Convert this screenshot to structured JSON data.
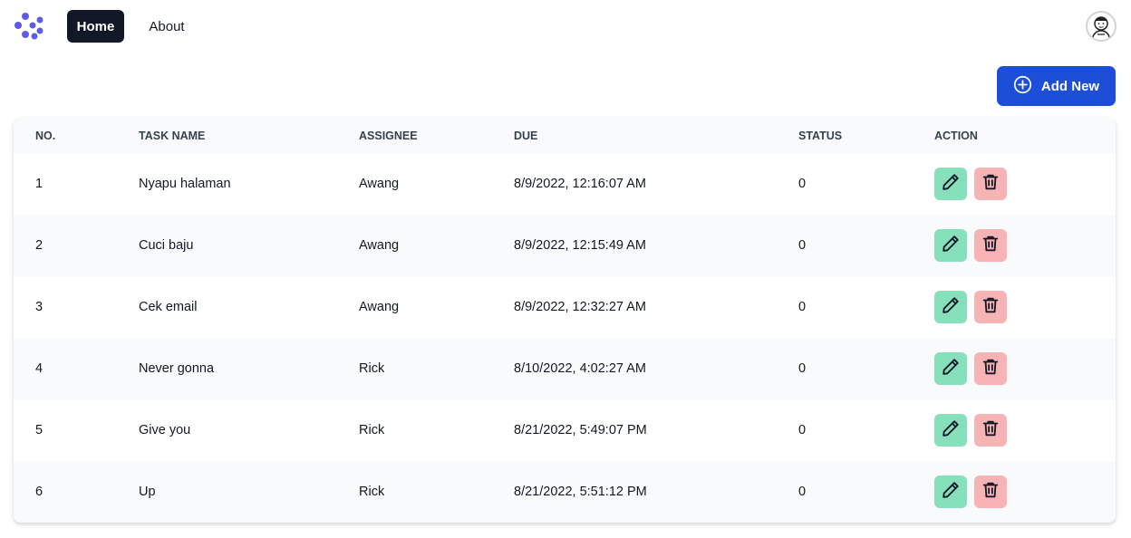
{
  "nav": {
    "logo_icon": "brand-logo-icon",
    "home_label": "Home",
    "about_label": "About",
    "avatar_icon": "user-avatar-icon"
  },
  "toolbar": {
    "add_label": "Add New",
    "add_icon": "plus-circle-icon"
  },
  "table": {
    "columns": [
      "No.",
      "Task Name",
      "Assignee",
      "Due",
      "Status",
      "Action"
    ],
    "rows": [
      {
        "no": "1",
        "task": "Nyapu halaman",
        "assignee": "Awang",
        "due": "8/9/2022, 12:16:07 AM",
        "status": "0"
      },
      {
        "no": "2",
        "task": "Cuci baju",
        "assignee": "Awang",
        "due": "8/9/2022, 12:15:49 AM",
        "status": "0"
      },
      {
        "no": "3",
        "task": "Cek email",
        "assignee": "Awang",
        "due": "8/9/2022, 12:32:27 AM",
        "status": "0"
      },
      {
        "no": "4",
        "task": "Never gonna",
        "assignee": "Rick",
        "due": "8/10/2022, 4:02:27 AM",
        "status": "0"
      },
      {
        "no": "5",
        "task": "Give you",
        "assignee": "Rick",
        "due": "8/21/2022, 5:49:07 PM",
        "status": "0"
      },
      {
        "no": "6",
        "task": "Up",
        "assignee": "Rick",
        "due": "8/21/2022, 5:51:12 PM",
        "status": "0"
      }
    ],
    "action_icons": [
      "pencil-icon",
      "trash-icon"
    ]
  },
  "colors": {
    "primary": "#1d4ed8",
    "nav_active": "#111827",
    "edit_bg": "#86e0bc",
    "delete_bg": "#f8b4b4",
    "logo": "#5b5be6"
  }
}
